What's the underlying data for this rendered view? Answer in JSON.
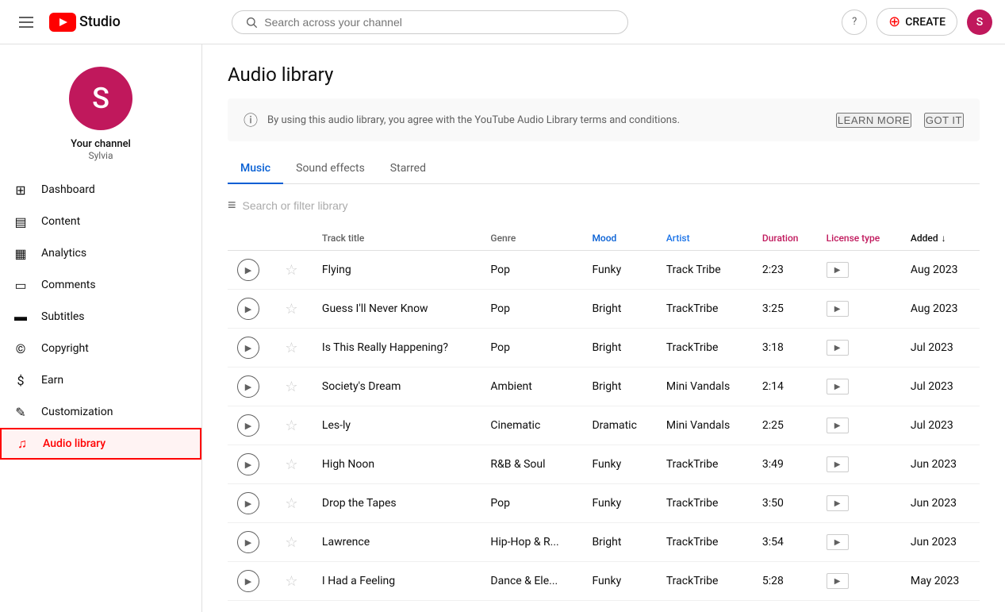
{
  "header": {
    "logo_text": "Studio",
    "search_placeholder": "Search across your channel",
    "help_label": "?",
    "create_label": "CREATE",
    "avatar_letter": "S"
  },
  "sidebar": {
    "channel_name": "Your channel",
    "channel_sub": "Sylvia",
    "avatar_letter": "S",
    "nav_items": [
      {
        "id": "dashboard",
        "label": "Dashboard",
        "icon": "⊞"
      },
      {
        "id": "content",
        "label": "Content",
        "icon": "▤"
      },
      {
        "id": "analytics",
        "label": "Analytics",
        "icon": "▦"
      },
      {
        "id": "comments",
        "label": "Comments",
        "icon": "▭"
      },
      {
        "id": "subtitles",
        "label": "Subtitles",
        "icon": "▬"
      },
      {
        "id": "copyright",
        "label": "Copyright",
        "icon": "©"
      },
      {
        "id": "earn",
        "label": "Earn",
        "icon": "$"
      },
      {
        "id": "customization",
        "label": "Customization",
        "icon": "✎"
      },
      {
        "id": "audio-library",
        "label": "Audio library",
        "icon": "♫",
        "active": true
      }
    ]
  },
  "main": {
    "page_title": "Audio library",
    "notice_text": "By using this audio library, you agree with the YouTube Audio Library terms and conditions.",
    "learn_more_label": "LEARN MORE",
    "got_it_label": "GOT IT",
    "tabs": [
      {
        "id": "music",
        "label": "Music",
        "active": true
      },
      {
        "id": "sound-effects",
        "label": "Sound effects",
        "active": false
      },
      {
        "id": "starred",
        "label": "Starred",
        "active": false
      }
    ],
    "filter_placeholder": "Search or filter library",
    "table": {
      "columns": [
        {
          "id": "play",
          "label": ""
        },
        {
          "id": "star",
          "label": ""
        },
        {
          "id": "track-title",
          "label": "Track title",
          "style": "normal"
        },
        {
          "id": "genre",
          "label": "Genre",
          "style": "normal"
        },
        {
          "id": "mood",
          "label": "Mood",
          "style": "blue"
        },
        {
          "id": "artist",
          "label": "Artist",
          "style": "artist"
        },
        {
          "id": "duration",
          "label": "Duration",
          "style": "accent"
        },
        {
          "id": "license",
          "label": "License type",
          "style": "accent"
        },
        {
          "id": "added",
          "label": "Added",
          "style": "sort",
          "sort": "↓"
        }
      ],
      "rows": [
        {
          "title": "Flying",
          "genre": "Pop",
          "mood": "Funky",
          "artist": "Track Tribe",
          "duration": "2:23",
          "added": "Aug 2023"
        },
        {
          "title": "Guess I'll Never Know",
          "genre": "Pop",
          "mood": "Bright",
          "artist": "TrackTribe",
          "duration": "3:25",
          "added": "Aug 2023"
        },
        {
          "title": "Is This Really Happening?",
          "genre": "Pop",
          "mood": "Bright",
          "artist": "TrackTribe",
          "duration": "3:18",
          "added": "Jul 2023"
        },
        {
          "title": "Society's Dream",
          "genre": "Ambient",
          "mood": "Bright",
          "artist": "Mini Vandals",
          "duration": "2:14",
          "added": "Jul 2023"
        },
        {
          "title": "Les-ly",
          "genre": "Cinematic",
          "mood": "Dramatic",
          "artist": "Mini Vandals",
          "duration": "2:25",
          "added": "Jul 2023"
        },
        {
          "title": "High Noon",
          "genre": "R&B & Soul",
          "mood": "Funky",
          "artist": "TrackTribe",
          "duration": "3:49",
          "added": "Jun 2023"
        },
        {
          "title": "Drop the Tapes",
          "genre": "Pop",
          "mood": "Funky",
          "artist": "TrackTribe",
          "duration": "3:50",
          "added": "Jun 2023"
        },
        {
          "title": "Lawrence",
          "genre": "Hip-Hop & R...",
          "mood": "Bright",
          "artist": "TrackTribe",
          "duration": "3:54",
          "added": "Jun 2023"
        },
        {
          "title": "I Had a Feeling",
          "genre": "Dance & Ele...",
          "mood": "Funky",
          "artist": "TrackTribe",
          "duration": "5:28",
          "added": "May 2023"
        }
      ]
    }
  }
}
